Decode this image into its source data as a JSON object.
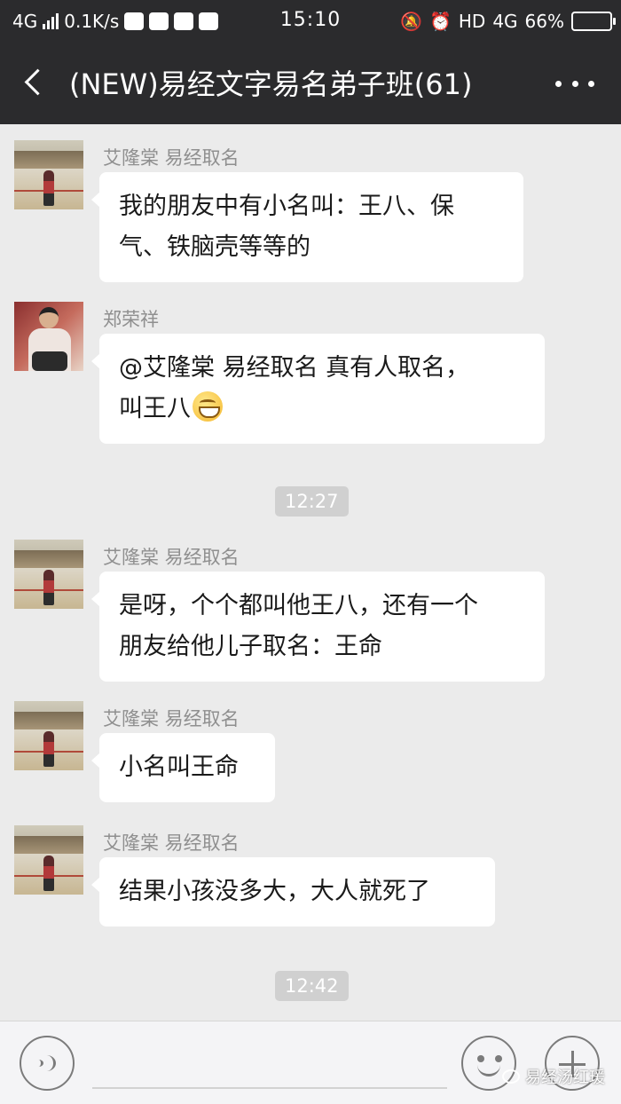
{
  "status_bar": {
    "network": "4G",
    "speed": "0.1K/s",
    "time": "15:10",
    "hd": "HD",
    "net_type": "4G",
    "battery_percent": "66%",
    "battery_level": 0.66,
    "left_icons": [
      "wechat-icon",
      "mail-icon",
      "qq-icon",
      "camera-icon"
    ],
    "right_icons": [
      "mute-icon",
      "alarm-icon"
    ]
  },
  "header": {
    "title": "(NEW)易经文字易名弟子班(61)"
  },
  "messages": [
    {
      "sender": "艾隆棠  易经取名",
      "text": "我的朋友中有小名叫：王八、保\n气、铁脑壳等等的"
    },
    {
      "sender": "郑荣祥",
      "text": "@艾隆棠  易经取名  真有人取名，\n叫王八",
      "emoji": "grin-emoji"
    },
    {
      "sender": "艾隆棠  易经取名",
      "text": "是呀，个个都叫他王八，还有一个\n朋友给他儿子取名：王命"
    },
    {
      "sender": "艾隆棠  易经取名",
      "text": "小名叫王命"
    },
    {
      "sender": "艾隆棠  易经取名",
      "text": "结果小孩没多大，大人就死了"
    }
  ],
  "timestamps": [
    "12:27",
    "12:42"
  ],
  "watermark": "易经汤红瑗",
  "colors": {
    "header_bg": "#2b2b2d",
    "chat_bg": "#ebebeb",
    "bubble_bg": "#ffffff",
    "battery_fill": "#4cd964"
  }
}
